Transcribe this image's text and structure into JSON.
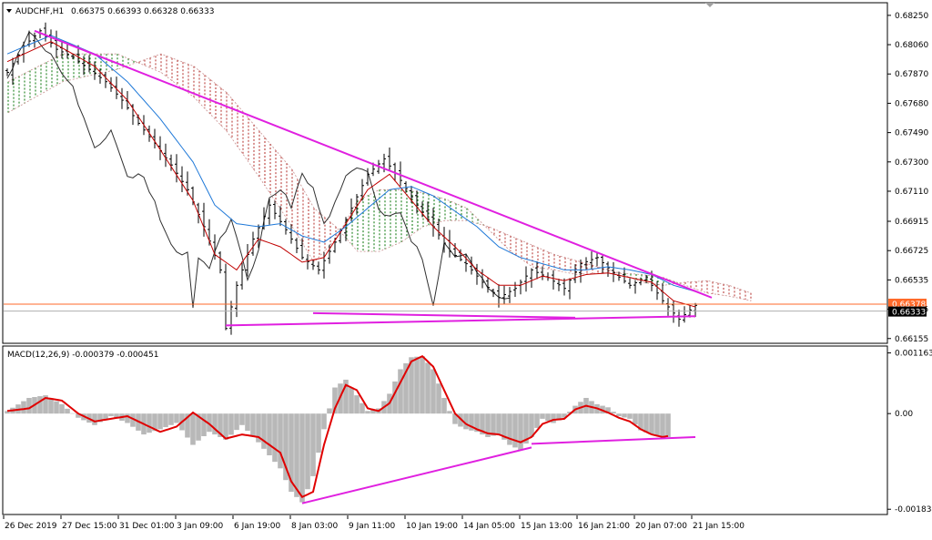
{
  "window": {
    "symbol_label": "AUDCHF,H1",
    "ohlc_label": "0.66375 0.66393 0.66328 0.66333",
    "macd_label": "MACD(12,26,9) -0.000379 -0.000451",
    "bid_price_label": "0.66333",
    "ask_price_label": "0.66378"
  },
  "colors": {
    "background": "#ffffff",
    "candles": "#000000",
    "trendline": "#e020e0",
    "price_line": "#ff6a2a",
    "kijun": "#c00000",
    "tenkan": "#1e78d8",
    "chikou": "#303030",
    "cloud_bear": "#c0504d",
    "cloud_bull": "#2e8b2e",
    "macd_hist": "#b8b8b8",
    "macd_signal": "#e00000"
  },
  "chart_data": [
    {
      "type": "candlestick",
      "name": "AUDCHF H1 price with Ichimoku",
      "y_ticks": [
        0.6825,
        0.6806,
        0.6787,
        0.6768,
        0.6749,
        0.673,
        0.6711,
        0.66915,
        0.66725,
        0.66535,
        0.66345,
        0.66155
      ],
      "y_tick_labels": [
        "0.68250",
        "0.68060",
        "0.67870",
        "0.67680",
        "0.67490",
        "0.67300",
        "0.67110",
        "0.66915",
        "0.66725",
        "0.66535",
        "0.66345",
        "0.66155"
      ],
      "ylim": [
        0.6613,
        0.6832
      ],
      "x_ticks": [
        "26 Dec 2019",
        "27 Dec 15:00",
        "31 Dec 01:00",
        "3 Jan 09:00",
        "6 Jan 19:00",
        "8 Jan 03:00",
        "9 Jan 11:00",
        "10 Jan 19:00",
        "14 Jan 05:00",
        "15 Jan 13:00",
        "16 Jan 21:00",
        "20 Jan 07:00",
        "21 Jan 15:00"
      ],
      "close_path": [
        [
          0,
          0.6788
        ],
        [
          3,
          0.6805
        ],
        [
          6,
          0.6815
        ],
        [
          9,
          0.6803
        ],
        [
          12,
          0.6798
        ],
        [
          15,
          0.679
        ],
        [
          18,
          0.6782
        ],
        [
          21,
          0.677
        ],
        [
          24,
          0.6755
        ],
        [
          27,
          0.6742
        ],
        [
          30,
          0.6728
        ],
        [
          33,
          0.6712
        ],
        [
          36,
          0.6688
        ],
        [
          39,
          0.666
        ],
        [
          40,
          0.6622
        ],
        [
          42,
          0.665
        ],
        [
          45,
          0.668
        ],
        [
          48,
          0.6702
        ],
        [
          51,
          0.6686
        ],
        [
          54,
          0.6668
        ],
        [
          57,
          0.666
        ],
        [
          60,
          0.6678
        ],
        [
          63,
          0.67
        ],
        [
          66,
          0.6722
        ],
        [
          69,
          0.6732
        ],
        [
          72,
          0.6718
        ],
        [
          75,
          0.6702
        ],
        [
          78,
          0.6688
        ],
        [
          81,
          0.6672
        ],
        [
          84,
          0.6664
        ],
        [
          87,
          0.6652
        ],
        [
          90,
          0.6642
        ],
        [
          93,
          0.6648
        ],
        [
          96,
          0.666
        ],
        [
          99,
          0.6655
        ],
        [
          102,
          0.6648
        ],
        [
          105,
          0.6664
        ],
        [
          108,
          0.6668
        ],
        [
          111,
          0.6658
        ],
        [
          114,
          0.665
        ],
        [
          117,
          0.6655
        ],
        [
          120,
          0.664
        ],
        [
          123,
          0.6628
        ],
        [
          126,
          0.6637
        ]
      ],
      "last_index": 126,
      "kijun": [
        [
          0,
          0.6795
        ],
        [
          8,
          0.6808
        ],
        [
          16,
          0.6792
        ],
        [
          22,
          0.677
        ],
        [
          28,
          0.6738
        ],
        [
          34,
          0.6705
        ],
        [
          38,
          0.667
        ],
        [
          42,
          0.666
        ],
        [
          46,
          0.668
        ],
        [
          50,
          0.6675
        ],
        [
          54,
          0.6665
        ],
        [
          58,
          0.6668
        ],
        [
          62,
          0.669
        ],
        [
          66,
          0.6712
        ],
        [
          70,
          0.6722
        ],
        [
          74,
          0.6705
        ],
        [
          78,
          0.6688
        ],
        [
          82,
          0.6675
        ],
        [
          86,
          0.666
        ],
        [
          90,
          0.665
        ],
        [
          94,
          0.665
        ],
        [
          98,
          0.6656
        ],
        [
          102,
          0.6653
        ],
        [
          106,
          0.6657
        ],
        [
          110,
          0.6658
        ],
        [
          114,
          0.6655
        ],
        [
          118,
          0.6652
        ],
        [
          122,
          0.664
        ],
        [
          126,
          0.6636
        ]
      ],
      "tenkan": [
        [
          0,
          0.68
        ],
        [
          8,
          0.6812
        ],
        [
          16,
          0.68
        ],
        [
          22,
          0.6782
        ],
        [
          28,
          0.6758
        ],
        [
          34,
          0.673
        ],
        [
          38,
          0.6702
        ],
        [
          42,
          0.669
        ],
        [
          46,
          0.6688
        ],
        [
          50,
          0.669
        ],
        [
          54,
          0.6682
        ],
        [
          58,
          0.6678
        ],
        [
          62,
          0.6688
        ],
        [
          66,
          0.67
        ],
        [
          70,
          0.6712
        ],
        [
          74,
          0.6714
        ],
        [
          78,
          0.6708
        ],
        [
          82,
          0.6698
        ],
        [
          86,
          0.6688
        ],
        [
          90,
          0.6675
        ],
        [
          94,
          0.6668
        ],
        [
          98,
          0.6664
        ],
        [
          102,
          0.666
        ],
        [
          106,
          0.666
        ],
        [
          110,
          0.6662
        ],
        [
          114,
          0.666
        ],
        [
          118,
          0.6657
        ],
        [
          122,
          0.665
        ],
        [
          126,
          0.6646
        ]
      ],
      "chikou": [
        [
          0,
          0.6785
        ],
        [
          4,
          0.6815
        ],
        [
          8,
          0.68
        ],
        [
          12,
          0.6778
        ],
        [
          16,
          0.6738
        ],
        [
          19,
          0.675
        ],
        [
          22,
          0.6722
        ],
        [
          25,
          0.672
        ],
        [
          28,
          0.6694
        ],
        [
          31,
          0.667
        ],
        [
          33,
          0.6672
        ],
        [
          34,
          0.6635
        ],
        [
          35,
          0.6668
        ],
        [
          37,
          0.666
        ],
        [
          39,
          0.668
        ],
        [
          41,
          0.6692
        ],
        [
          44,
          0.6655
        ],
        [
          46,
          0.6672
        ],
        [
          48,
          0.6708
        ],
        [
          50,
          0.6712
        ],
        [
          52,
          0.6702
        ],
        [
          54,
          0.6722
        ],
        [
          56,
          0.6712
        ],
        [
          58,
          0.669
        ],
        [
          60,
          0.6702
        ],
        [
          62,
          0.672
        ],
        [
          64,
          0.6728
        ],
        [
          66,
          0.6725
        ],
        [
          68,
          0.67
        ],
        [
          70,
          0.6694
        ],
        [
          72,
          0.6696
        ],
        [
          74,
          0.668
        ],
        [
          76,
          0.6668
        ],
        [
          78,
          0.6638
        ],
        [
          80,
          0.6676
        ],
        [
          82,
          0.6668
        ],
        [
          84,
          0.6672
        ],
        [
          86,
          0.666
        ],
        [
          88,
          0.6648
        ],
        [
          90,
          0.6642
        ],
        [
          92,
          0.664
        ]
      ],
      "cloud_a": [
        [
          0,
          0.6782
        ],
        [
          10,
          0.68
        ],
        [
          20,
          0.68
        ],
        [
          28,
          0.6788
        ],
        [
          34,
          0.6772
        ],
        [
          40,
          0.675
        ],
        [
          46,
          0.672
        ],
        [
          52,
          0.6688
        ],
        [
          56,
          0.6665
        ],
        [
          60,
          0.668
        ],
        [
          64,
          0.6705
        ],
        [
          68,
          0.6712
        ],
        [
          72,
          0.6712
        ],
        [
          76,
          0.671
        ],
        [
          80,
          0.6706
        ],
        [
          84,
          0.67
        ],
        [
          88,
          0.6686
        ],
        [
          92,
          0.6672
        ],
        [
          96,
          0.6662
        ],
        [
          100,
          0.666
        ],
        [
          104,
          0.6657
        ],
        [
          108,
          0.6658
        ],
        [
          112,
          0.6658
        ],
        [
          116,
          0.6657
        ],
        [
          120,
          0.6655
        ],
        [
          124,
          0.665
        ],
        [
          128,
          0.6645
        ],
        [
          132,
          0.6643
        ],
        [
          136,
          0.664
        ]
      ],
      "cloud_b": [
        [
          0,
          0.6762
        ],
        [
          10,
          0.6782
        ],
        [
          20,
          0.679
        ],
        [
          28,
          0.68
        ],
        [
          34,
          0.6792
        ],
        [
          40,
          0.6775
        ],
        [
          46,
          0.675
        ],
        [
          52,
          0.6725
        ],
        [
          56,
          0.67
        ],
        [
          60,
          0.6688
        ],
        [
          64,
          0.6672
        ],
        [
          68,
          0.6672
        ],
        [
          72,
          0.6678
        ],
        [
          76,
          0.6688
        ],
        [
          80,
          0.6692
        ],
        [
          84,
          0.6692
        ],
        [
          88,
          0.6688
        ],
        [
          92,
          0.6682
        ],
        [
          96,
          0.6676
        ],
        [
          100,
          0.667
        ],
        [
          104,
          0.6666
        ],
        [
          108,
          0.6662
        ],
        [
          112,
          0.6658
        ],
        [
          116,
          0.6652
        ],
        [
          120,
          0.665
        ],
        [
          124,
          0.6652
        ],
        [
          128,
          0.6653
        ],
        [
          132,
          0.665
        ],
        [
          136,
          0.6645
        ]
      ],
      "trendlines": [
        {
          "from": [
            5,
            0.6815
          ],
          "to": [
            129,
            0.6642
          ]
        },
        {
          "from": [
            56,
            0.6632
          ],
          "to": [
            104,
            0.6629
          ]
        },
        {
          "from": [
            40,
            0.6624
          ],
          "to": [
            126,
            0.663
          ]
        }
      ]
    },
    {
      "type": "bar",
      "name": "MACD(12,26,9)",
      "y_tick_labels": [
        "0.001163",
        "0.00",
        "-0.001834"
      ],
      "y_ticks": [
        0.001163,
        0.0,
        -0.001834
      ],
      "ylim": [
        -0.0019,
        0.00126
      ],
      "hist_path": [
        [
          0,
          5e-05
        ],
        [
          4,
          0.0003
        ],
        [
          7,
          0.00035
        ],
        [
          10,
          0.00018
        ],
        [
          13,
          -8e-05
        ],
        [
          16,
          -0.00022
        ],
        [
          19,
          -5e-05
        ],
        [
          22,
          -0.00018
        ],
        [
          25,
          -0.0004
        ],
        [
          28,
          -0.0003
        ],
        [
          31,
          -0.00018
        ],
        [
          34,
          -0.0006
        ],
        [
          37,
          -0.00035
        ],
        [
          40,
          -0.0005
        ],
        [
          43,
          -0.00022
        ],
        [
          46,
          -0.00055
        ],
        [
          48,
          -0.0008
        ],
        [
          50,
          -0.00105
        ],
        [
          52,
          -0.0015
        ],
        [
          54,
          -0.0017
        ],
        [
          56,
          -0.0012
        ],
        [
          58,
          -0.0003
        ],
        [
          60,
          0.0005
        ],
        [
          62,
          0.00065
        ],
        [
          64,
          0.00035
        ],
        [
          66,
          5e-05
        ],
        [
          68,
          0.0001
        ],
        [
          70,
          0.00038
        ],
        [
          72,
          0.00085
        ],
        [
          74,
          0.00108
        ],
        [
          76,
          0.0011
        ],
        [
          78,
          0.00085
        ],
        [
          80,
          0.0003
        ],
        [
          82,
          -0.0002
        ],
        [
          84,
          -0.0003
        ],
        [
          86,
          -0.00035
        ],
        [
          88,
          -0.00045
        ],
        [
          90,
          -0.0004
        ],
        [
          92,
          -0.0006
        ],
        [
          94,
          -0.0007
        ],
        [
          96,
          -0.00045
        ],
        [
          98,
          -0.0001
        ],
        [
          100,
          -0.00018
        ],
        [
          102,
          -8e-05
        ],
        [
          104,
          0.00015
        ],
        [
          106,
          0.0003
        ],
        [
          108,
          0.00018
        ],
        [
          110,
          0.00012
        ],
        [
          112,
          -5e-05
        ],
        [
          114,
          -0.0001
        ],
        [
          116,
          -0.00032
        ],
        [
          118,
          -0.0004
        ],
        [
          120,
          -0.00045
        ]
      ],
      "signal_path": [
        [
          0,
          5e-05
        ],
        [
          4,
          0.0001
        ],
        [
          7,
          0.0003
        ],
        [
          10,
          0.00025
        ],
        [
          13,
          0.0
        ],
        [
          16,
          -0.00015
        ],
        [
          19,
          -0.0001
        ],
        [
          22,
          -5e-05
        ],
        [
          25,
          -0.0002
        ],
        [
          28,
          -0.00035
        ],
        [
          31,
          -0.00025
        ],
        [
          34,
          2e-05
        ],
        [
          37,
          -0.0002
        ],
        [
          40,
          -0.00048
        ],
        [
          43,
          -0.0004
        ],
        [
          46,
          -0.00045
        ],
        [
          48,
          -0.0006
        ],
        [
          50,
          -0.00075
        ],
        [
          52,
          -0.0013
        ],
        [
          54,
          -0.0016
        ],
        [
          56,
          -0.0015
        ],
        [
          58,
          -0.0006
        ],
        [
          60,
          0.0001
        ],
        [
          62,
          0.00055
        ],
        [
          64,
          0.00045
        ],
        [
          66,
          0.0001
        ],
        [
          68,
          5e-05
        ],
        [
          70,
          0.0002
        ],
        [
          72,
          0.0006
        ],
        [
          74,
          0.001
        ],
        [
          76,
          0.0011
        ],
        [
          78,
          0.0009
        ],
        [
          80,
          0.00045
        ],
        [
          82,
          0.0
        ],
        [
          84,
          -0.0002
        ],
        [
          86,
          -0.0003
        ],
        [
          88,
          -0.00038
        ],
        [
          90,
          -0.0004
        ],
        [
          92,
          -0.00048
        ],
        [
          94,
          -0.00055
        ],
        [
          96,
          -0.00045
        ],
        [
          98,
          -0.0002
        ],
        [
          100,
          -0.00012
        ],
        [
          102,
          -0.0001
        ],
        [
          104,
          8e-05
        ],
        [
          106,
          0.00015
        ],
        [
          108,
          0.0001
        ],
        [
          110,
          2e-05
        ],
        [
          112,
          -8e-05
        ],
        [
          114,
          -0.00015
        ],
        [
          116,
          -0.0003
        ],
        [
          118,
          -0.0004
        ],
        [
          120,
          -0.00045
        ],
        [
          121,
          -0.00043
        ]
      ],
      "trendlines": [
        {
          "from": [
            54,
            -0.00172
          ],
          "to": [
            96,
            -0.00065
          ]
        },
        {
          "from": [
            96,
            -0.00058
          ],
          "to": [
            126,
            -0.00045
          ]
        }
      ]
    }
  ]
}
